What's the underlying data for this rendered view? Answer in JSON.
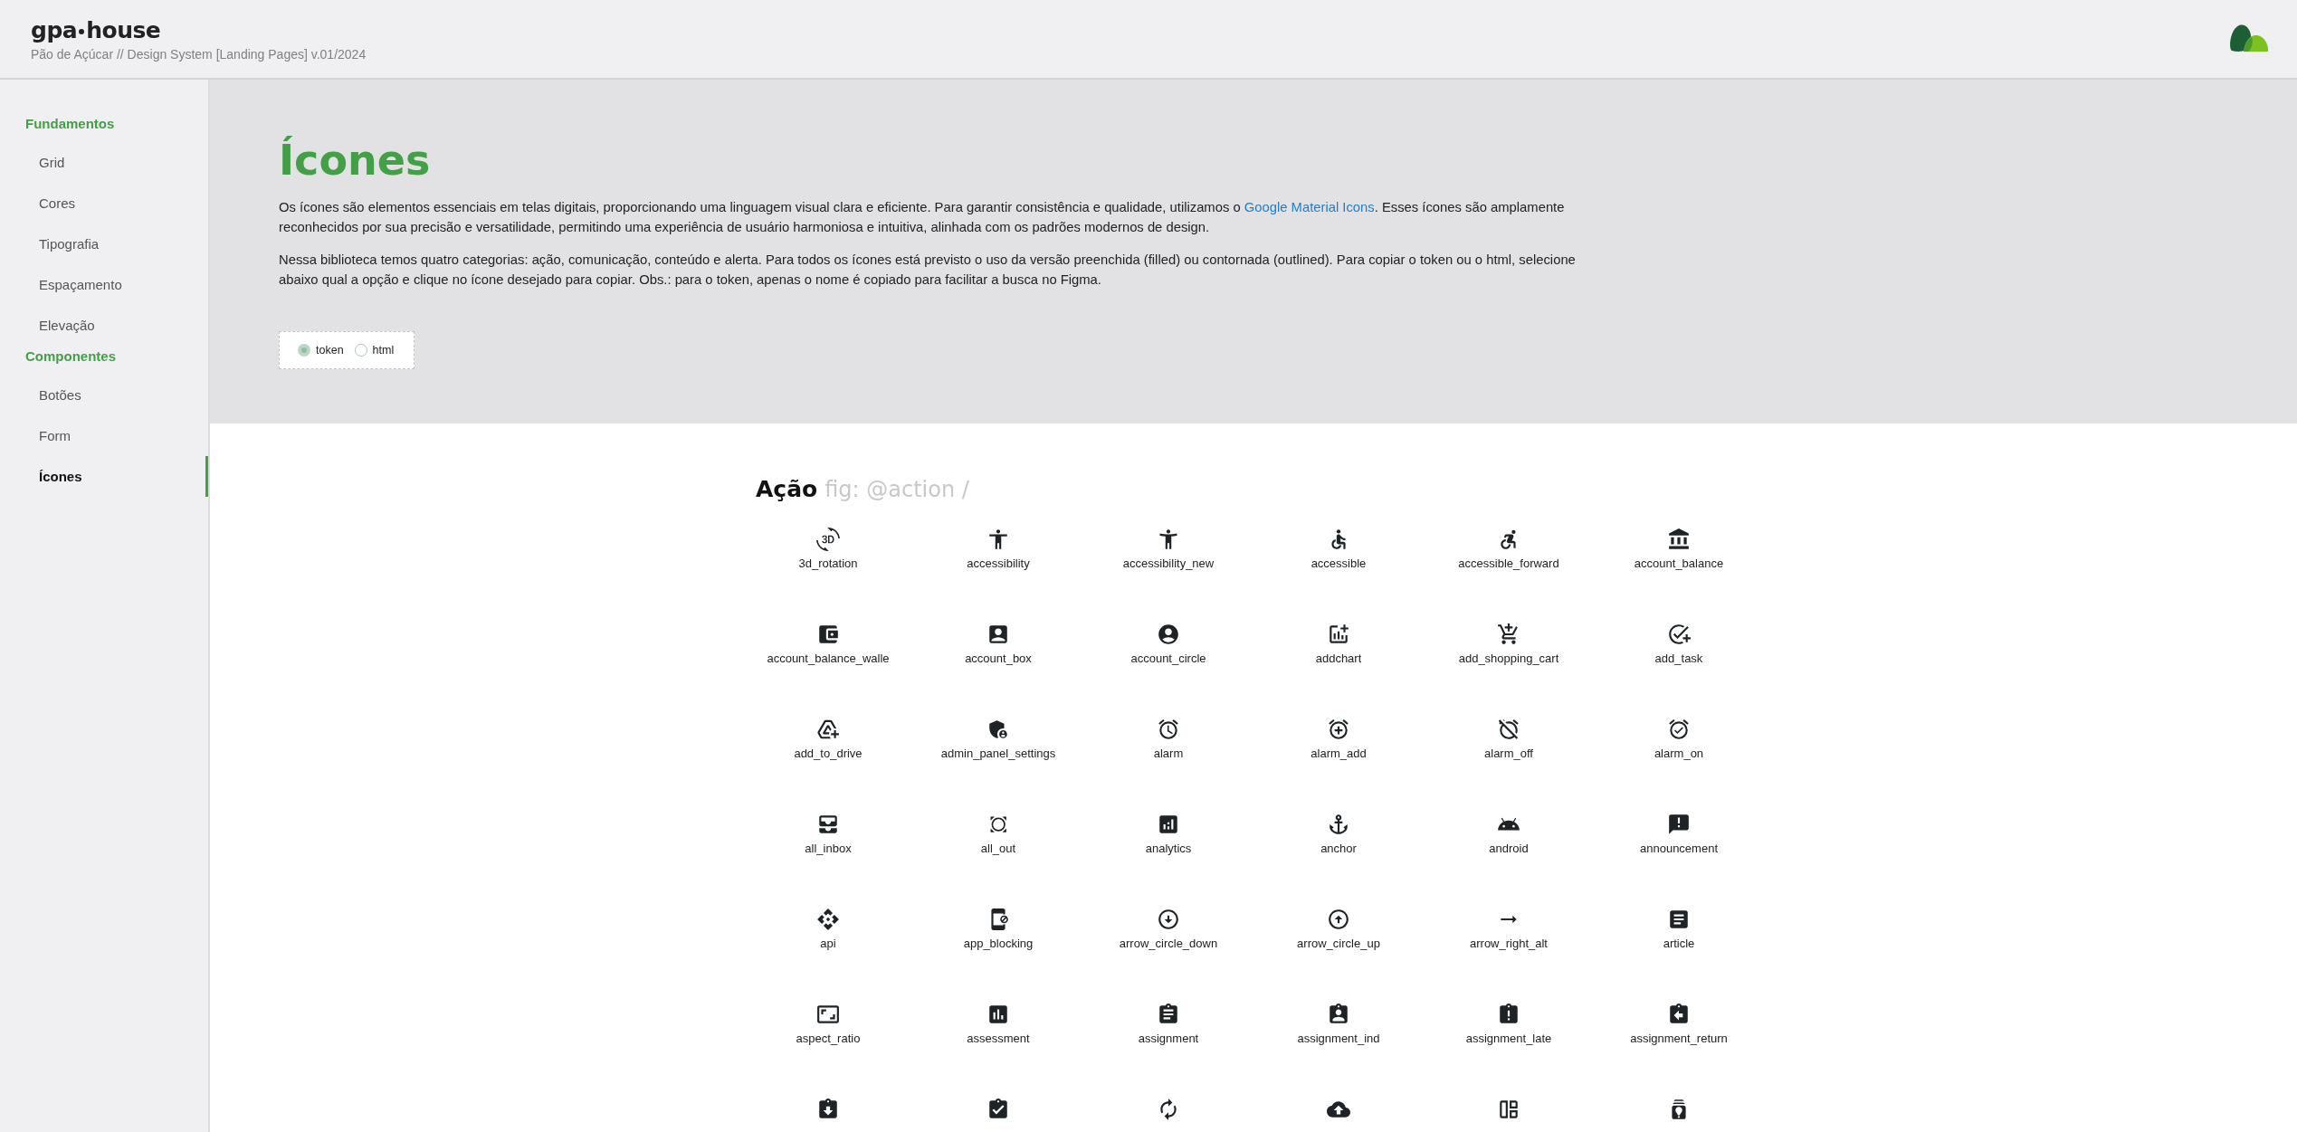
{
  "header": {
    "brand_left": "gpa",
    "brand_right": "house",
    "subtitle": "Pão de Açúcar // Design System [Landing Pages] v.01/2024"
  },
  "sidebar": {
    "groups": [
      {
        "title": "Fundamentos",
        "items": [
          {
            "label": "Grid",
            "selected": false
          },
          {
            "label": "Cores",
            "selected": false
          },
          {
            "label": "Tipografia",
            "selected": false
          },
          {
            "label": "Espaçamento",
            "selected": false
          },
          {
            "label": "Elevação",
            "selected": false
          }
        ]
      },
      {
        "title": "Componentes",
        "items": [
          {
            "label": "Botões",
            "selected": false
          },
          {
            "label": "Form",
            "selected": false
          },
          {
            "label": "Ícones",
            "selected": true
          }
        ]
      }
    ]
  },
  "intro": {
    "title": "Ícones",
    "paragraphs": [
      {
        "before": "Os ícones são elementos essenciais em telas digitais, proporcionando uma linguagem visual clara e eficiente. Para garantir consistência e qualidade, utilizamos o ",
        "link": "Google Material Icons",
        "after": ". Esses ícones são amplamente reconhecidos por sua precisão e versatilidade, permitindo uma experiência de usuário harmoniosa e intuitiva, alinhada com os padrões modernos de design."
      },
      {
        "before": "Nessa biblioteca temos quatro categorias: ação, comunicação, conteúdo e alerta. Para todos os ícones está previsto o uso da versão preenchida (filled) ou contornada (outlined). Para copiar o token ou o html, selecione abaixo qual a opção e clique no ícone desejado para copiar. Obs.: para o token, apenas o nome é copiado para facilitar a busca no Figma."
      }
    ],
    "copy_options": [
      {
        "label": "token",
        "selected": true
      },
      {
        "label": "html",
        "selected": false
      }
    ]
  },
  "section": {
    "title": "Ação",
    "subtitle": "fig: @action /",
    "icons": [
      {
        "kind": "labeled",
        "label": "3d_rotation"
      },
      {
        "kind": "labeled",
        "label": "accessibility"
      },
      {
        "kind": "labeled",
        "label": "accessibility_new"
      },
      {
        "kind": "labeled",
        "label": "accessible"
      },
      {
        "kind": "labeled",
        "label": "accessible_forward"
      },
      {
        "kind": "labeled",
        "label": "account_balance"
      },
      {
        "kind": "labeled",
        "label": "account_balance_walle"
      },
      {
        "kind": "labeled",
        "label": "account_box"
      },
      {
        "kind": "labeled",
        "label": "account_circle"
      },
      {
        "kind": "labeled",
        "label": "addchart"
      },
      {
        "kind": "labeled",
        "label": "add_shopping_cart"
      },
      {
        "kind": "labeled",
        "label": "add_task"
      },
      {
        "kind": "labeled",
        "label": "add_to_drive"
      },
      {
        "kind": "labeled",
        "label": "admin_panel_settings"
      },
      {
        "kind": "labeled",
        "label": "alarm"
      },
      {
        "kind": "labeled",
        "label": "alarm_add"
      },
      {
        "kind": "labeled",
        "label": "alarm_off"
      },
      {
        "kind": "labeled",
        "label": "alarm_on"
      },
      {
        "kind": "labeled",
        "label": "all_inbox"
      },
      {
        "kind": "labeled",
        "label": "all_out"
      },
      {
        "kind": "labeled",
        "label": "analytics"
      },
      {
        "kind": "labeled",
        "label": "anchor"
      },
      {
        "kind": "labeled",
        "label": "android"
      },
      {
        "kind": "labeled",
        "label": "announcement"
      },
      {
        "kind": "labeled",
        "label": "api"
      },
      {
        "kind": "labeled",
        "label": "app_blocking"
      },
      {
        "kind": "labeled",
        "label": "arrow_circle_down"
      },
      {
        "kind": "labeled",
        "label": "arrow_circle_up"
      },
      {
        "kind": "labeled",
        "label": "arrow_right_alt"
      },
      {
        "kind": "labeled",
        "label": "article"
      },
      {
        "kind": "labeled",
        "label": "aspect_ratio"
      },
      {
        "kind": "labeled",
        "label": "assessment"
      },
      {
        "kind": "labeled",
        "label": "assignment"
      },
      {
        "kind": "labeled",
        "label": "assignment_ind"
      },
      {
        "kind": "labeled",
        "label": "assignment_late"
      },
      {
        "kind": "labeled",
        "label": "assignment_return"
      },
      {
        "kind": "cut"
      },
      {
        "kind": "cut"
      },
      {
        "kind": "cut"
      },
      {
        "kind": "cut"
      },
      {
        "kind": "cut"
      },
      {
        "kind": "cut"
      }
    ]
  }
}
